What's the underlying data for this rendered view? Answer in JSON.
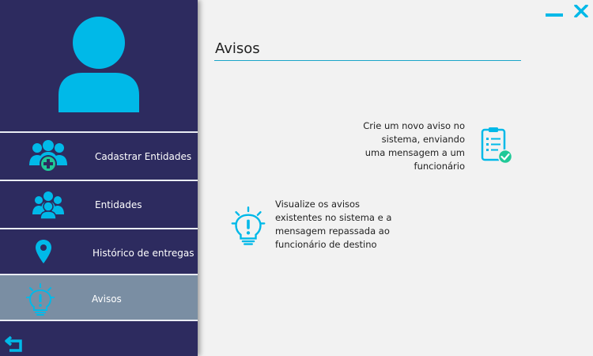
{
  "accent": "#00b4e6",
  "sidebar_color": "#2d2b5f",
  "active_color": "#7a8ea3",
  "sidebar": {
    "avatar_icon": "user-avatar-icon",
    "items": [
      {
        "label": "Cadastrar Entidades",
        "icon": "add-users-icon"
      },
      {
        "label": "Entidades",
        "icon": "users-group-icon"
      },
      {
        "label": "Histórico de entregas",
        "icon": "map-pin-icon"
      },
      {
        "label": "Avisos",
        "icon": "lightbulb-alert-icon",
        "active": true
      }
    ],
    "back_icon": "back-arrow-icon"
  },
  "window": {
    "minimize_icon": "minimize-icon",
    "close_icon": "close-icon"
  },
  "main": {
    "title": "Avisos",
    "cards": [
      {
        "text": "Crie um novo aviso no sistema, enviando uma mensagem a um funcionário",
        "icon": "clipboard-check-icon"
      },
      {
        "text": "Visualize os avisos existentes no sistema e a mensagem repassada ao funcionário de destino",
        "icon": "lightbulb-alert-icon"
      }
    ]
  }
}
